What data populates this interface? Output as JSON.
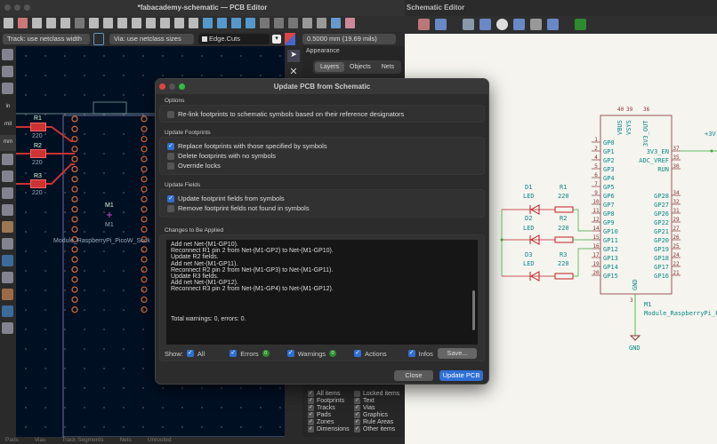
{
  "schematic": {
    "title": "c — Schematic Editor",
    "parts": {
      "m1_ref": "M1",
      "m1_value": "Module_RaspberryPi_P",
      "gnd": "GND",
      "vplus": "+3V",
      "top_pins": [
        {
          "num": "40",
          "name": "VBUS"
        },
        {
          "num": "39",
          "name": "VSYS"
        },
        {
          "num": "36",
          "name": "3V3_OUT"
        }
      ],
      "left_pins": [
        {
          "num": "1",
          "name": "GP0"
        },
        {
          "num": "2",
          "name": "GP1"
        },
        {
          "num": "4",
          "name": "GP2"
        },
        {
          "num": "5",
          "name": "GP3"
        },
        {
          "num": "6",
          "name": "GP4"
        },
        {
          "num": "7",
          "name": "GP5"
        },
        {
          "num": "9",
          "name": "GP6"
        },
        {
          "num": "10",
          "name": "GP7"
        },
        {
          "num": "11",
          "name": "GP8"
        },
        {
          "num": "12",
          "name": "GP9"
        },
        {
          "num": "14",
          "name": "GP10"
        },
        {
          "num": "15",
          "name": "GP11"
        },
        {
          "num": "16",
          "name": "GP12"
        },
        {
          "num": "17",
          "name": "GP13"
        },
        {
          "num": "19",
          "name": "GP14"
        },
        {
          "num": "20",
          "name": "GP15"
        }
      ],
      "right_pins": [
        {
          "num": "37",
          "name": "3V3_EN"
        },
        {
          "num": "35",
          "name": "ADC_VREF"
        },
        {
          "num": "30",
          "name": "RUN"
        },
        {
          "num": "",
          "name": ""
        },
        {
          "num": "",
          "name": ""
        },
        {
          "num": "34",
          "name": "GP28"
        },
        {
          "num": "32",
          "name": "GP27"
        },
        {
          "num": "31",
          "name": "GP26"
        },
        {
          "num": "29",
          "name": "GP22"
        },
        {
          "num": "27",
          "name": "GP21"
        },
        {
          "num": "26",
          "name": "GP20"
        },
        {
          "num": "25",
          "name": "GP19"
        },
        {
          "num": "24",
          "name": "GP18"
        },
        {
          "num": "22",
          "name": "GP17"
        },
        {
          "num": "21",
          "name": "GP16"
        }
      ],
      "gnd_pin": {
        "num": "3",
        "name": "GND"
      },
      "leds": [
        {
          "ref": "D1",
          "value": "LED"
        },
        {
          "ref": "D2",
          "value": "LED"
        },
        {
          "ref": "D3",
          "value": "LED"
        }
      ],
      "resistors": [
        {
          "ref": "R1",
          "value": "220"
        },
        {
          "ref": "R2",
          "value": "220"
        },
        {
          "ref": "R3",
          "value": "220"
        }
      ]
    }
  },
  "pcb": {
    "title": "*fabacademy-schematic — PCB Editor",
    "track_select": "Track: use netclass width",
    "via_select": "Via: use netclass sizes",
    "layer_select": "Edge.Cuts",
    "grid_select": "0.5000 mm (19.69 mils)",
    "left_tools": [
      "in",
      "mil",
      "mm"
    ],
    "canvas": {
      "resistors": [
        {
          "ref": "R1",
          "value": "220"
        },
        {
          "ref": "R2",
          "value": "220"
        },
        {
          "ref": "R3",
          "value": "220"
        }
      ],
      "module_ref": "M1",
      "module_ref2": "M1",
      "module_footprint": "Module_RaspberryPi_PicoW_Sock"
    },
    "appearance": {
      "title": "Appearance",
      "tabs": [
        "Layers",
        "Objects",
        "Nets"
      ],
      "filter": [
        {
          "label": "All items",
          "checked": true
        },
        {
          "label": "Locked items",
          "checked": false
        },
        {
          "label": "Footprints",
          "checked": true
        },
        {
          "label": "Text",
          "checked": true
        },
        {
          "label": "Tracks",
          "checked": true
        },
        {
          "label": "Vias",
          "checked": true
        },
        {
          "label": "Pads",
          "checked": true
        },
        {
          "label": "Graphics",
          "checked": true
        },
        {
          "label": "Zones",
          "checked": true
        },
        {
          "label": "Rule Areas",
          "checked": true
        },
        {
          "label": "Dimensions",
          "checked": true
        },
        {
          "label": "Other items",
          "checked": true
        }
      ]
    },
    "status": [
      "Pads",
      "Vias",
      "Track Segments",
      "Nets",
      "Unrouted"
    ]
  },
  "dialog": {
    "title": "Update PCB from Schematic",
    "options_label": "Options",
    "relink": {
      "label": "Re-link footprints to schematic symbols based on their reference designators",
      "checked": false
    },
    "footprints_label": "Update Footprints",
    "footprints": [
      {
        "label": "Replace footprints with those specified by symbols",
        "checked": true
      },
      {
        "label": "Delete footprints with no symbols",
        "checked": false
      },
      {
        "label": "Override locks",
        "checked": false
      }
    ],
    "fields_label": "Update Fields",
    "fields": [
      {
        "label": "Update footprint fields from symbols",
        "checked": true
      },
      {
        "label": "Remove footprint fields not found in symbols",
        "checked": false
      }
    ],
    "changes_label": "Changes to Be Applied",
    "log": [
      "Add net Net-(M1-GP10).",
      "Reconnect R1 pin 2 from Net-(M1-GP2) to Net-(M1-GP10).",
      "Update R2 fields.",
      "Add net Net-(M1-GP11).",
      "Reconnect R2 pin 2 from Net-(M1-GP3) to Net-(M1-GP11).",
      "Update R3 fields.",
      "Add net Net-(M1-GP12).",
      "Reconnect R3 pin 2 from Net-(M1-GP4) to Net-(M1-GP12)."
    ],
    "summary": "Total warnings: 0, errors: 0.",
    "show_label": "Show:",
    "show": {
      "all": "All",
      "errors": "Errors",
      "errors_count": "0",
      "warnings": "Warnings",
      "warnings_count": "0",
      "actions": "Actions",
      "infos": "Infos"
    },
    "save": "Save...",
    "close": "Close",
    "update": "Update PCB"
  }
}
